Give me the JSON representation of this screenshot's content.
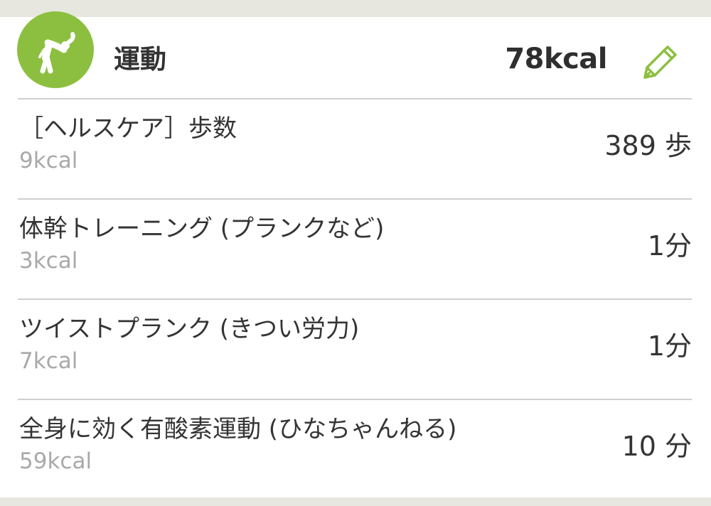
{
  "section": {
    "title": "運動",
    "total_kcal": "78kcal",
    "badge_icon": "stretching-person-icon",
    "edit_icon": "pencil-icon",
    "accent_color": "#8cbf3f"
  },
  "exercises": [
    {
      "name": "［ヘルスケア］歩数",
      "kcal": "9kcal",
      "amount": "389 歩"
    },
    {
      "name": "体幹トレーニング (プランクなど)",
      "kcal": "3kcal",
      "amount": "1分"
    },
    {
      "name": "ツイストプランク (きつい労力)",
      "kcal": "7kcal",
      "amount": "1分"
    },
    {
      "name": "全身に効く有酸素運動 (ひなちゃんねる)",
      "kcal": "59kcal",
      "amount": "10 分"
    }
  ]
}
